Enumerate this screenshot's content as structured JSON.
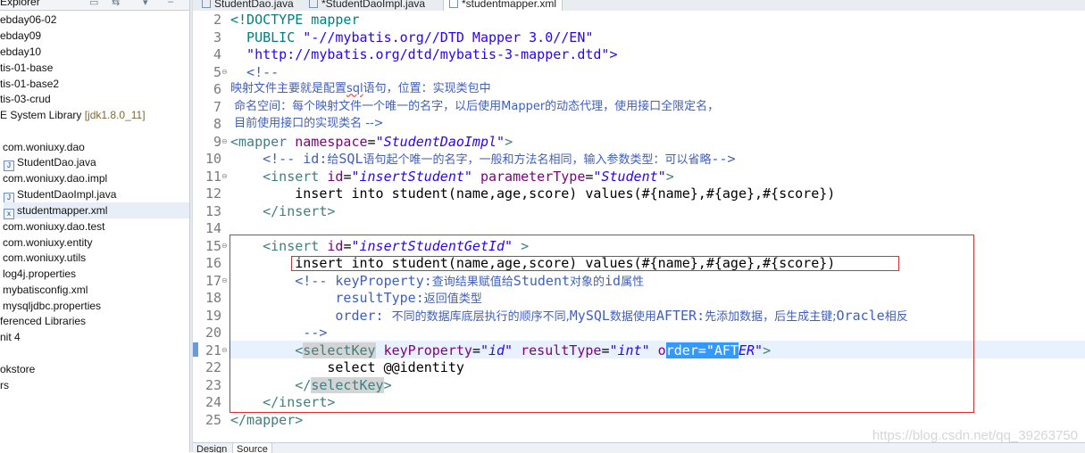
{
  "explorer": {
    "title": "Explorer",
    "items": [
      {
        "label": "ebday06-02",
        "icon": "project-icon"
      },
      {
        "label": "ebday09",
        "icon": "project-icon"
      },
      {
        "label": "ebday10",
        "icon": "project-icon"
      },
      {
        "label": "tis-01-base",
        "icon": "project-icon"
      },
      {
        "label": "tis-01-base2",
        "icon": "project-icon"
      },
      {
        "label": "tis-03-crud",
        "icon": "project-icon"
      },
      {
        "label": "E System Library",
        "suffix": "[jdk1.8.0_11]",
        "icon": "library-icon"
      },
      {
        "label": "com.woniuxy.dao",
        "icon": "package-icon"
      },
      {
        "label": "StudentDao.java",
        "icon": "java-file-icon"
      },
      {
        "label": "com.woniuxy.dao.impl",
        "icon": "package-icon"
      },
      {
        "label": "StudentDaoImpl.java",
        "icon": "java-file-icon"
      },
      {
        "label": "studentmapper.xml",
        "icon": "xml-file-icon"
      },
      {
        "label": "com.woniuxy.dao.test",
        "icon": "package-icon"
      },
      {
        "label": "com.woniuxy.entity",
        "icon": "package-icon"
      },
      {
        "label": "com.woniuxy.utils",
        "icon": "package-icon"
      },
      {
        "label": "log4j.properties",
        "icon": "properties-file-icon"
      },
      {
        "label": "mybatisconfig.xml",
        "icon": "xml-file-icon"
      },
      {
        "label": "mysqljdbc.properties",
        "icon": "properties-file-icon"
      },
      {
        "label": "ferenced Libraries",
        "icon": "library-icon"
      },
      {
        "label": "nit 4",
        "icon": "library-icon"
      },
      {
        "label": "",
        "icon": ""
      },
      {
        "label": "okstore",
        "icon": "project-icon"
      },
      {
        "label": "rs",
        "icon": "project-icon"
      }
    ]
  },
  "tabs": [
    {
      "label": "StudentDao.java",
      "icon": "java-file-icon"
    },
    {
      "label": "*StudentDaoImpl.java",
      "icon": "java-file-icon"
    },
    {
      "label": "*studentmapper.xml",
      "icon": "xml-file-icon"
    }
  ],
  "editor": {
    "lines": [
      {
        "n": "2",
        "fold": ""
      },
      {
        "n": "3",
        "fold": ""
      },
      {
        "n": "4",
        "fold": ""
      },
      {
        "n": "5",
        "fold": "⊖"
      },
      {
        "n": "6",
        "fold": ""
      },
      {
        "n": "7",
        "fold": ""
      },
      {
        "n": "8",
        "fold": ""
      },
      {
        "n": "9",
        "fold": "⊖"
      },
      {
        "n": "10",
        "fold": ""
      },
      {
        "n": "11",
        "fold": "⊖"
      },
      {
        "n": "12",
        "fold": ""
      },
      {
        "n": "13",
        "fold": ""
      },
      {
        "n": "14",
        "fold": ""
      },
      {
        "n": "15",
        "fold": "⊖"
      },
      {
        "n": "16",
        "fold": ""
      },
      {
        "n": "17",
        "fold": "⊖"
      },
      {
        "n": "18",
        "fold": ""
      },
      {
        "n": "19",
        "fold": ""
      },
      {
        "n": "20",
        "fold": ""
      },
      {
        "n": "21",
        "fold": "⊖"
      },
      {
        "n": "22",
        "fold": ""
      },
      {
        "n": "23",
        "fold": ""
      },
      {
        "n": "24",
        "fold": ""
      },
      {
        "n": "25",
        "fold": ""
      }
    ],
    "code": {
      "l2": "<!DOCTYPE mapper",
      "l3a": "  PUBLIC ",
      "l3b": "\"-//mybatis.org//DTD Mapper 3.0//EN\"",
      "l4": "  \"http://mybatis.org/dtd/mybatis-3-mapper.dtd\">",
      "l5": "  <!--",
      "l6a": "映射文件主要就是配置",
      "l6b": "sql",
      "l6c": "语句，位置：实现类包中",
      "l7a": " 命名空间：每个映射文件一个唯一的名字，以后使用",
      "l7b": "Mapper",
      "l7c": "的动态代理，使用接口全限定名，",
      "l8": " 目前使用接口的实现类名 -->",
      "l9a": "<mapper ",
      "l9b": "namespace",
      "l9c": "=",
      "l9d": "\"StudentDaoImpl\"",
      "l9e": ">",
      "l10a": "    <!-- id:",
      "l10b": "给",
      "l10c": "SQL",
      "l10d": "语句起个唯一的名字，一般和方法名相同，输入参数类型：可以省略",
      "l10e": "-->",
      "l11a": "    <insert ",
      "l11b": "id",
      "l11c": "=",
      "l11d": "\"insertStudent\"",
      "l11e": " parameterType",
      "l11f": "=",
      "l11g": "\"Student\"",
      "l11h": ">",
      "l12": "        insert into student(name,age,score) values(#{name},#{age},#{score})",
      "l13": "    </insert>",
      "l15a": "    <insert ",
      "l15b": "id",
      "l15c": "=",
      "l15d": "\"insertStudentGetId\"",
      "l15e": " >",
      "l16": "        insert into student(name,age,score) values(#{name},#{age},#{score})",
      "l17a": "        <!-- ",
      "l17b": "keyProperty:",
      "l17c": "查询结果赋值给",
      "l17d": "Student",
      "l17e": "对象的",
      "l17f": "id",
      "l17g": "属性",
      "l18a": "             resultType:",
      "l18b": "返回值类型",
      "l19a": "             order: ",
      "l19b": "不同的数据库底层执行的顺序不同,",
      "l19c": "MySQL",
      "l19d": "数据使用",
      "l19e": "AFTER:",
      "l19f": "先添加数据，后生成主键;",
      "l19g": "Oracle",
      "l19h": "相反",
      "l20": "         -->",
      "l21a": "        <",
      "l21b": "selectKey",
      "l21c": " keyProperty",
      "l21d": "=",
      "l21e": "\"id\"",
      "l21f": " resultType",
      "l21g": "=",
      "l21h": "\"int\"",
      "l21i": " o",
      "l21j": "rder=\"AFT",
      "l21k": "ER\"",
      "l21l": ">",
      "l22": "            select @@identity",
      "l23a": "        </",
      "l23b": "selectKey",
      "l23c": ">",
      "l24": "    </insert>",
      "l25": "</mapper>"
    }
  },
  "bottom_tabs": [
    {
      "label": "Design"
    },
    {
      "label": "Source"
    }
  ],
  "watermark": "https://blog.csdn.net/qq_39263750",
  "colors": {
    "tag": "#3f7f7f",
    "attr": "#7f007f",
    "value": "#2a00ff",
    "comment": "#3f5fbf",
    "selection": "#3399ff",
    "annotation_box": "#e22b2b"
  }
}
